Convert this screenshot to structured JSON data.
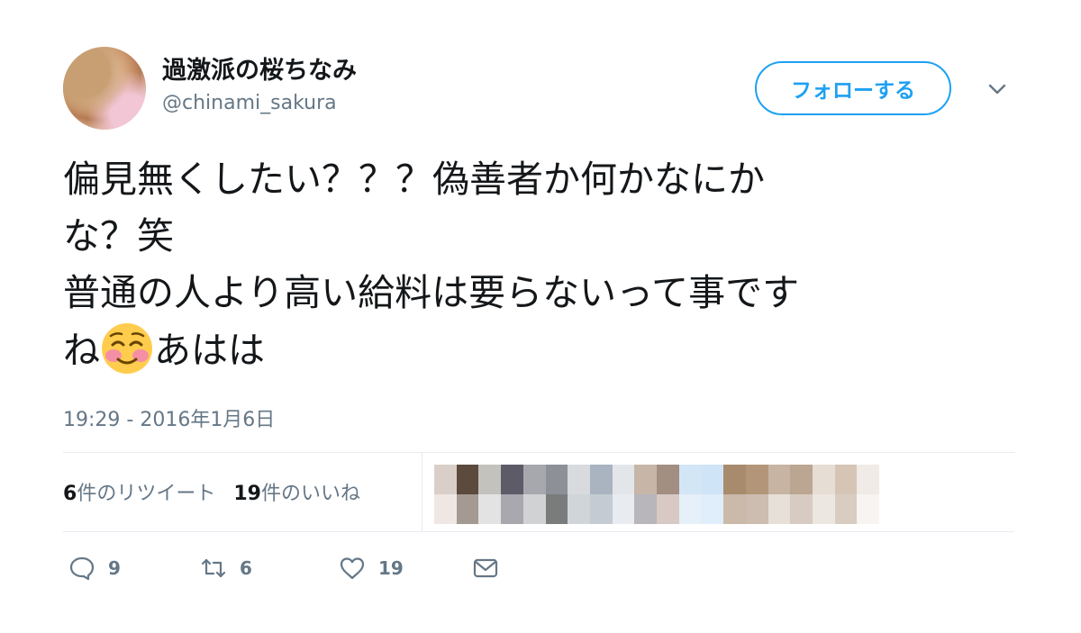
{
  "user": {
    "display_name": "過激派の桜ちなみ",
    "handle": "@chinami_sakura"
  },
  "follow_button_label": "フォローする",
  "tweet": {
    "line1": "偏見無くしたい？？？偽善者か何かなにか",
    "line2": "な？笑",
    "line3": "普通の人より高い給料は要らないって事です",
    "line4_prefix": "ね",
    "emoji": "smiling-face-with-blush-icon",
    "line4_suffix": "あはは"
  },
  "timestamp": "19:29 - 2016年1月6日",
  "stats": {
    "retweets_count": "6",
    "retweets_label": "件のリツイート",
    "likes_count": "19",
    "likes_label": "件のいいね"
  },
  "liker_avatars_blurred": [
    "#d9cfc8",
    "#5b4a3d",
    "#c4c2bd",
    "#5e5b68",
    "#a7a8ad",
    "#8d9097",
    "#d8dadd",
    "#a9b4c0",
    "#e2e6ea",
    "#c7b6a8",
    "#a38e82",
    "#d3e6f6",
    "#cfe4f6",
    "#a88a6c",
    "#b39679",
    "#c8b4a2",
    "#bba691",
    "#e6ddd5",
    "#d6c5b5",
    "#f0ebe6",
    "#efe7e4",
    "#a49a92",
    "#e3e3e3",
    "#a8a8ae",
    "#d0d2d4",
    "#7a7c7b",
    "#d0d5d9",
    "#c4cbd2",
    "#e8ebef",
    "#b8b5bb",
    "#d8c9c4",
    "#e6f0f9",
    "#dfeefa",
    "#cbb9aa",
    "#cdbdb0",
    "#e6e0d8",
    "#d8cbc1",
    "#ece7e0",
    "#d9ccc0",
    "#f7f4f1"
  ],
  "actions": {
    "reply_count": "9",
    "retweet_count": "6",
    "like_count": "19"
  },
  "colors": {
    "accent": "#1da1f2",
    "secondary_text": "#657786",
    "primary_text": "#14171a",
    "divider": "#e6ecf0"
  }
}
